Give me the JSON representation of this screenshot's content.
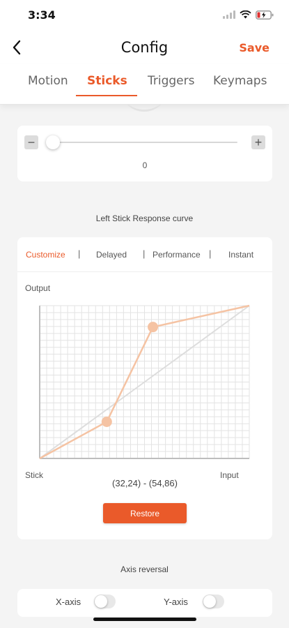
{
  "status": {
    "time": "3:34"
  },
  "nav": {
    "title": "Config",
    "save_label": "Save"
  },
  "tabs": [
    {
      "label": "Motion",
      "active": false
    },
    {
      "label": "Sticks",
      "active": true
    },
    {
      "label": "Triggers",
      "active": false
    },
    {
      "label": "Keymaps",
      "active": false
    }
  ],
  "slider": {
    "minus": "−",
    "plus": "+",
    "value": "0",
    "level": 0
  },
  "curve_section": {
    "title": "Left Stick Response curve",
    "presets": [
      "Customize",
      "Delayed",
      "Performance",
      "Instant"
    ],
    "separator": "|",
    "active_preset": "Customize",
    "y_label": "Output",
    "x_label_left": "Stick",
    "x_label_right": "Input",
    "control_points": [
      {
        "x": 32,
        "y": 24
      },
      {
        "x": 54,
        "y": 86
      }
    ],
    "coords_text": "(32,24) - (54,86)",
    "restore_label": "Restore"
  },
  "axis_section": {
    "title": "Axis reversal",
    "x_axis_label": "X-axis",
    "y_axis_label": "Y-axis",
    "x_axis_on": false,
    "y_axis_on": false
  },
  "colors": {
    "accent": "#ea5a2a",
    "curve": "#f5c3a3",
    "grid": "#e3e3e3",
    "diagonal": "#dddddd"
  }
}
